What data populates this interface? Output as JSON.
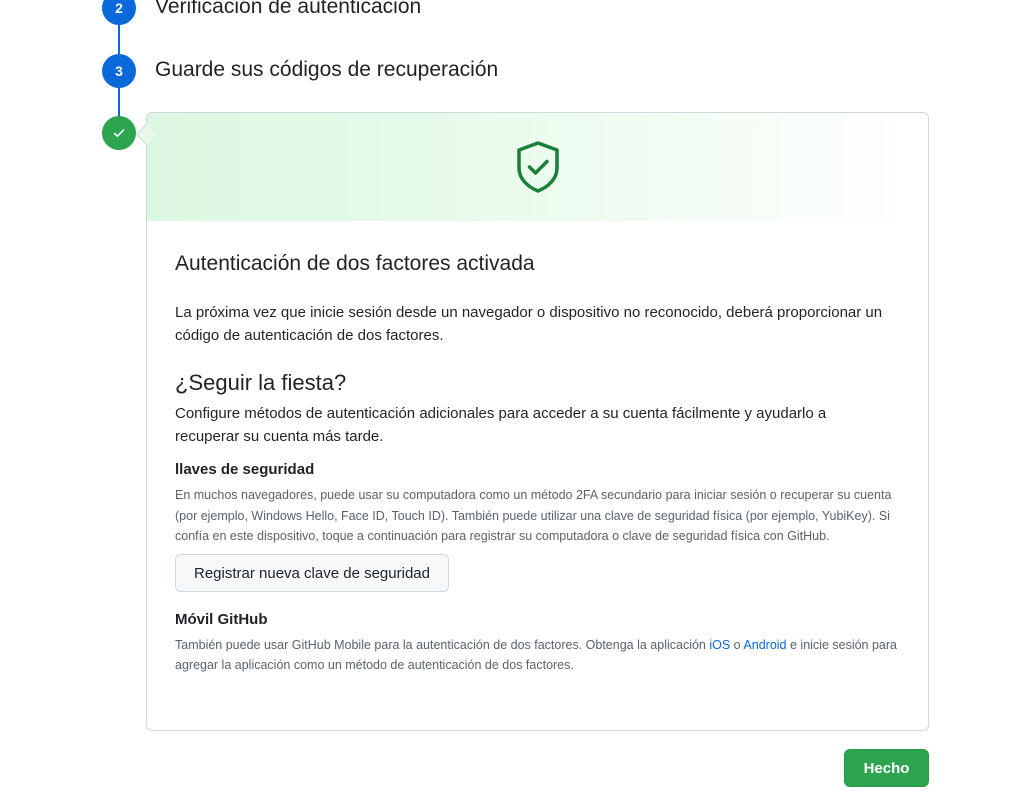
{
  "stepper": {
    "steps": [
      {
        "number": "2",
        "title": "Verificación de autenticación"
      },
      {
        "number": "3",
        "title": "Guarde sus códigos de recuperación"
      }
    ],
    "completed_icon": "check-icon"
  },
  "card": {
    "hero_icon": "shield-check-icon",
    "hero_color": "#1a7f37",
    "title": "Autenticación de dos factores activada",
    "description": "La próxima vez que inicie sesión desde un navegador o dispositivo no reconocido, deberá proporcionar un código de autenticación de dos factores.",
    "section_heading": "¿Seguir la fiesta?",
    "section_description": "Configure métodos de autenticación adicionales para acceder a su cuenta fácilmente y ayudarlo a recuperar su cuenta más tarde.",
    "security_keys": {
      "heading": "llaves de seguridad",
      "text": "En muchos navegadores, puede usar su computadora como un método 2FA secundario para iniciar sesión o recuperar su cuenta (por ejemplo, Windows Hello, Face ID, Touch ID). También puede utilizar una clave de seguridad física (por ejemplo, YubiKey). Si confía en este dispositivo, toque a continuación para registrar su computadora o clave de seguridad física con GitHub.",
      "button_label": "Registrar nueva clave de seguridad"
    },
    "mobile": {
      "heading": "Móvil GitHub",
      "text_before": "También puede usar GitHub Mobile para la autenticación de dos factores. Obtenga la aplicación ",
      "ios_link": "iOS",
      "text_or": " o ",
      "android_link": "Android",
      "text_after": " e inicie sesión para agregar la aplicación como un método de autenticación de dos factores."
    }
  },
  "footer": {
    "done_label": "Hecho"
  },
  "colors": {
    "accent": "#0969da",
    "success": "#2da44e"
  }
}
